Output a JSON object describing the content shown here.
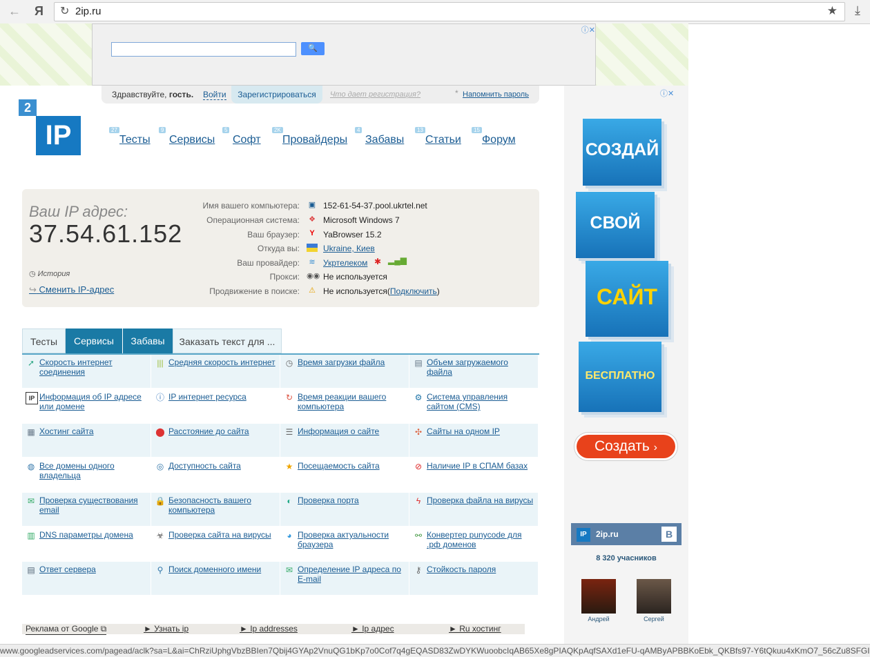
{
  "browser": {
    "url": "2ip.ru",
    "yandex_glyph": "Я"
  },
  "ad_top": {
    "search_button": "🔍",
    "ad_icons": "ⓘ✕"
  },
  "login": {
    "greet_prefix": "Здравствуйте,",
    "greet_name": "гость.",
    "login": "Войти",
    "register": "Зарегистрироваться",
    "what": "Что дает регистрация?",
    "remind": "Напомнить пароль"
  },
  "logo": {
    "small": "2",
    "big": "IP"
  },
  "nav": [
    {
      "label": "Тесты",
      "count": "27"
    },
    {
      "label": "Сервисы",
      "count": "9"
    },
    {
      "label": "Софт",
      "count": "5"
    },
    {
      "label": "Провайдеры",
      "count": "2K"
    },
    {
      "label": "Забавы",
      "count": "4"
    },
    {
      "label": "Статьи",
      "count": "13"
    },
    {
      "label": "Форум",
      "count": "15"
    }
  ],
  "ip": {
    "label": "Ваш IP адрес:",
    "value": "37.54.61.152",
    "history": "История",
    "change": "Сменить IP-адрес",
    "rows": [
      {
        "key": "Имя вашего компьютера:",
        "value": "152-61-54-37.pool.ukrtel.net",
        "icon": "computer-icon"
      },
      {
        "key": "Операционная система:",
        "value": "Microsoft Windows 7",
        "icon": "windows-icon"
      },
      {
        "key": "Ваш браузер:",
        "value": "YaBrowser 15.2",
        "icon": "yandex-browser-icon"
      },
      {
        "key": "Откуда вы:",
        "value": "Ukraine, Киев",
        "icon": "ukraine-flag-icon"
      },
      {
        "key": "Ваш провайдер:",
        "value": "Укртелеком",
        "icon": "provider-icon"
      },
      {
        "key": "Прокси:",
        "value": "Не используется",
        "icon": "glasses-icon"
      },
      {
        "key": "Продвижение в поиске:",
        "value": "Не используется",
        "icon": "warning-icon"
      }
    ],
    "promo_open": "(",
    "promo_link": "Подключить",
    "promo_close": ")"
  },
  "tabs": [
    "Тесты",
    "Сервисы",
    "Забавы",
    "Заказать текст для ..."
  ],
  "services": [
    [
      "Скорость интернет соединения",
      "Средняя скорость интернет",
      "Время загрузки файла",
      "Объем загружаемого файла"
    ],
    [
      "Информация об IP адресе или домене",
      "IP интернет ресурса",
      "Время реакции вашего компьютера",
      "Система управления сайтом (CMS)"
    ],
    [
      "Хостинг сайта",
      "Расстояние до сайта",
      "Информация о сайте",
      "Сайты на одном IP"
    ],
    [
      "Все домены одного владельца",
      "Доступность сайта",
      "Посещаемость сайта",
      "Наличие IP в СПАМ базах"
    ],
    [
      "Проверка существования email",
      "Безопасность вашего компьютера",
      "Проверка порта",
      "Проверка файла на вирусы"
    ],
    [
      "DNS параметры домена",
      "Проверка сайта на вирусы",
      "Проверка актуальности браузера",
      "Конвертер punycode для .рф доменов"
    ],
    [
      "Ответ сервера",
      "Поиск доменного имени",
      "Определение IP адреса по E-mail",
      "Стойкость пароля"
    ]
  ],
  "google_ads": {
    "label": "Реклама от Google",
    "links": [
      "► Узнать ip",
      "► Ip addresses",
      "► Ip адрес",
      "► Ru хостинг"
    ]
  },
  "status_url": "www.googleadservices.com/pagead/aclk?sa=L&ai=ChRziUphgVbzBBIen7Qbij4GYAp2VnuQG1bKp7o0Cof7q4gEQASD83ZwDYKWuoobcIqAB65Xe8gPIAQKpAqfSAXd1eFU-qAMByAPBBKoEbk_QKBfs97-Y6tQkuu4xKmO7_56cZu8SFGIG9irG...",
  "right_ad": {
    "blocks": [
      "СОЗДАЙ",
      "СВОЙ",
      "САЙТ",
      "БЕСПЛАТНО"
    ],
    "button": "Создать",
    "button_arrow": "›"
  },
  "vk": {
    "name": "2ip.ru",
    "vb": "В",
    "members": "8 320 учасников",
    "users": [
      "Андрей",
      "Сергей"
    ]
  },
  "colors": {
    "accent": "#1a7aa5",
    "link": "#1a5c93",
    "cta": "#e8421b"
  }
}
